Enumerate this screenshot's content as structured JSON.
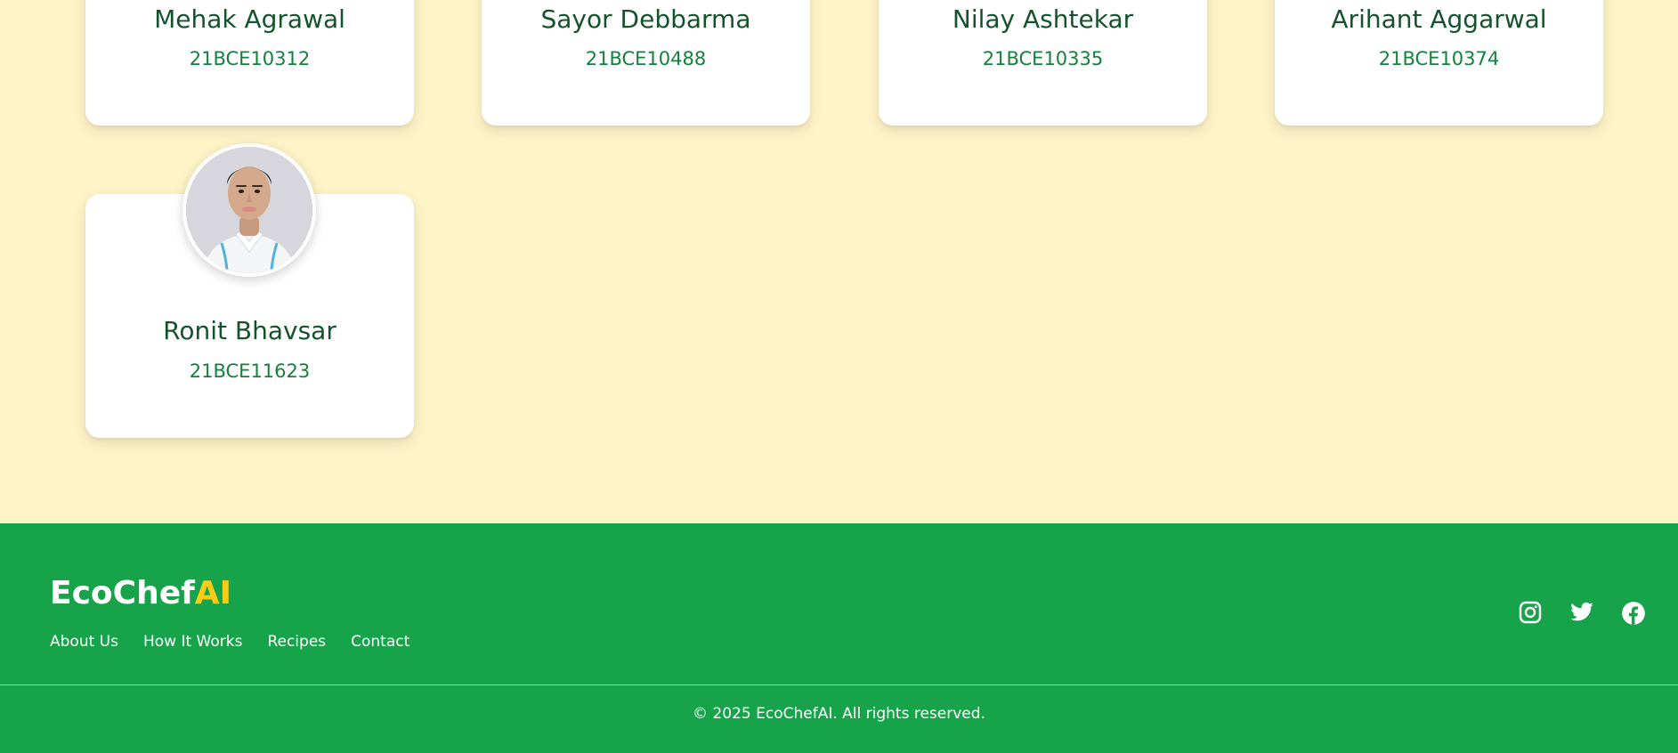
{
  "team": {
    "members": [
      {
        "name": "Mehak Agrawal",
        "id": "21BCE10312"
      },
      {
        "name": "Sayor Debbarma",
        "id": "21BCE10488"
      },
      {
        "name": "Nilay Ashtekar",
        "id": "21BCE10335"
      },
      {
        "name": "Arihant Aggarwal",
        "id": "21BCE10374"
      },
      {
        "name": "Ronit Bhavsar",
        "id": "21BCE11623"
      }
    ]
  },
  "footer": {
    "brand_main": "EcoChef",
    "brand_accent": "AI",
    "links": [
      "About Us",
      "How It Works",
      "Recipes",
      "Contact"
    ],
    "socials": [
      "instagram-icon",
      "twitter-icon",
      "facebook-icon"
    ],
    "copyright": "© 2025 EcoChefAI. All rights reserved."
  },
  "colors": {
    "page_background": "#fef3c7",
    "footer_green": "#16a34a",
    "name_text": "#14532d",
    "id_text": "#15803d",
    "brand_accent": "#facc15"
  }
}
